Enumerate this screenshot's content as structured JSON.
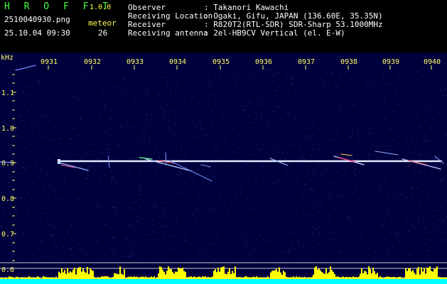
{
  "header": {
    "app_name": "HROFFT",
    "version": "1.0.0",
    "filename": "2510040930.png",
    "datetime": "25.10.04 09:30",
    "meteor_label": "meteor",
    "meteor_count": "26",
    "info": [
      {
        "label": "Observer",
        "value": ": Takanori Kawachi"
      },
      {
        "label": "Receiving Location",
        "value": ": Ogaki, Gifu, JAPAN (136.60E, 35.35N)"
      },
      {
        "label": "Receiver",
        "value": ": R820T2(RTL-SDR) SDR-Sharp 53.1000MHz"
      },
      {
        "label": "Receiving antenna",
        "value": ": 2el-HB9CV Vertical (el. E-W)"
      }
    ]
  },
  "spectrogram": {
    "freq_unit": "kHz",
    "time_labels": [
      "0931",
      "0932",
      "0933",
      "0934",
      "0935",
      "0936",
      "0937",
      "0938",
      "0939",
      "0940"
    ],
    "freq_labels": [
      "1.1",
      "1.0",
      "0.9",
      "0.8",
      "0.7",
      "0.6"
    ],
    "colors": {
      "background": "#00003c",
      "axis_text": "#ffff66",
      "signal": "#b4c8ff",
      "amplitude_fill": "#ffff00",
      "baseline_fill": "#00ffff"
    }
  }
}
